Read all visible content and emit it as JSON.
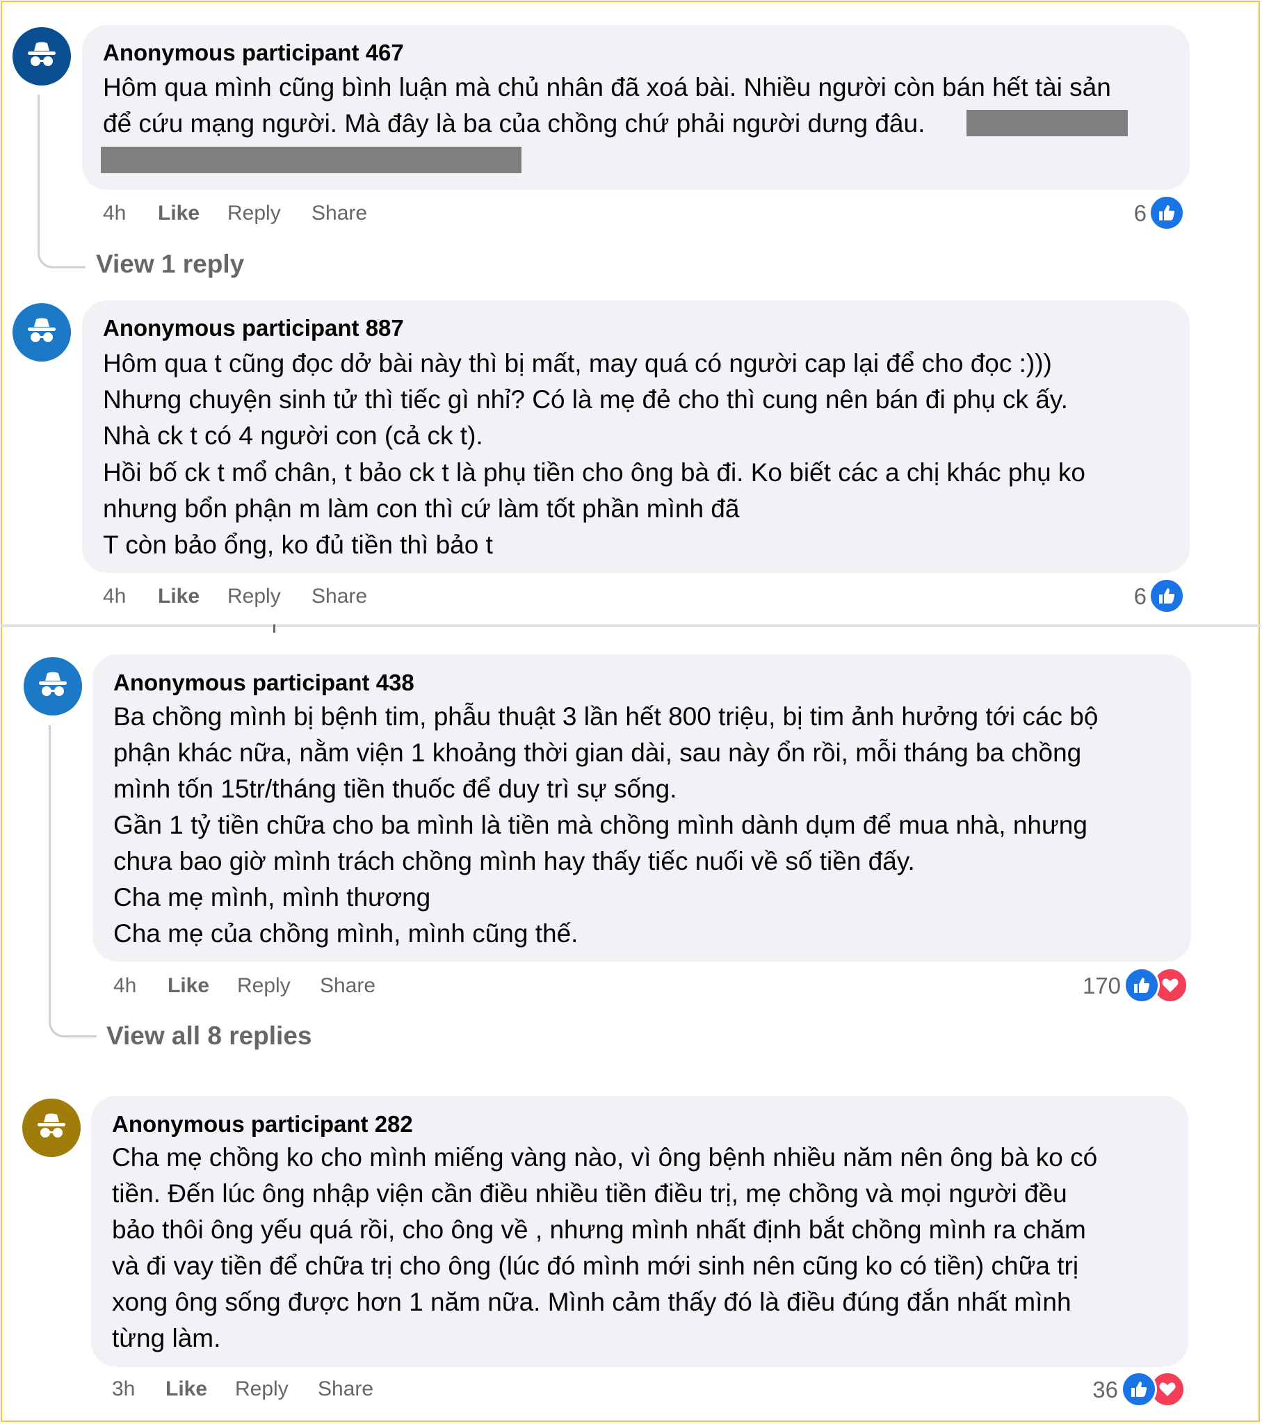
{
  "actions": {
    "like": "Like",
    "reply": "Reply",
    "share": "Share"
  },
  "colors": {
    "avatar_blue_dark": "#0a4f92",
    "avatar_blue": "#1b79c6",
    "avatar_gold": "#a07d0a",
    "like_blue": "#1b74e4",
    "love_red": "#f33e58",
    "frame_border": "#f2c14a"
  },
  "comments": [
    {
      "author": "Anonymous participant 467",
      "lines": [
        "Hôm qua mình cũng bình luận mà chủ nhân đã xoá bài. Nhiều người còn bán hết tài sản",
        "để cứu mạng người. Mà đây là ba của chồng chứ phải người dưng đâu."
      ],
      "time": "4h",
      "reaction_count": "6",
      "reactions": [
        "like"
      ],
      "view_replies": "View 1 reply",
      "avatar_icon": "incognito-icon"
    },
    {
      "author": "Anonymous participant 887",
      "lines": [
        "Hôm qua t cũng đọc dở bài này thì bị mất, may quá có người cap lại để cho đọc :)))",
        "Nhưng chuyện sinh tử thì tiếc gì nhỉ? Có là mẹ đẻ cho thì cung nên bán đi phụ ck ấy.",
        "Nhà ck t có 4 người con (cả ck t).",
        "Hồi bố ck t mổ chân, t bảo ck t là phụ tiền cho ông bà đi. Ko biết các a chị khác phụ ko",
        "nhưng bổn phận m làm con thì cứ làm tốt phần mình đã",
        "T còn bảo ổng, ko đủ tiền thì bảo t"
      ],
      "time": "4h",
      "reaction_count": "6",
      "reactions": [
        "like"
      ],
      "avatar_icon": "incognito-icon"
    },
    {
      "author": "Anonymous participant 438",
      "lines": [
        "Ba chồng mình bị bệnh tim, phẫu thuật 3 lần hết 800 triệu, bị tim ảnh hưởng tới các bộ",
        "phận khác nữa, nằm viện 1 khoảng thời gian dài, sau này ổn rồi, mỗi tháng ba chồng",
        "mình tốn 15tr/tháng tiền thuốc để duy trì sự sống.",
        "Gần 1 tỷ tiền chữa cho ba mình là tiền mà chồng mình dành dụm để mua nhà, nhưng",
        "chưa bao giờ mình trách chồng mình hay thấy tiếc nuối về số tiền đấy.",
        "Cha mẹ mình, mình thương",
        "Cha mẹ của chồng mình, mình cũng thế."
      ],
      "time": "4h",
      "reaction_count": "170",
      "reactions": [
        "like",
        "love"
      ],
      "view_replies": "View all 8 replies",
      "avatar_icon": "incognito-icon"
    },
    {
      "author": "Anonymous participant 282",
      "lines": [
        "Cha mẹ chồng ko cho mình miếng vàng nào, vì ông bệnh nhiều năm nên ông bà ko có",
        "tiền. Đến lúc ông nhập viện cần điều nhiều tiền điều trị, mẹ chồng và mọi người đều",
        "bảo thôi ông yếu quá rồi, cho ông về , nhưng mình nhất định bắt chồng mình ra chăm",
        "và đi vay tiền để chữa trị cho ông (lúc đó mình mới sinh nên cũng ko có tiền) chữa trị",
        "xong ông sống được hơn 1 năm nữa. Mình cảm thấy đó là điều đúng đắn nhất mình",
        "từng làm."
      ],
      "time": "3h",
      "reaction_count": "36",
      "reactions": [
        "like",
        "love"
      ],
      "avatar_icon": "incognito-icon"
    }
  ]
}
